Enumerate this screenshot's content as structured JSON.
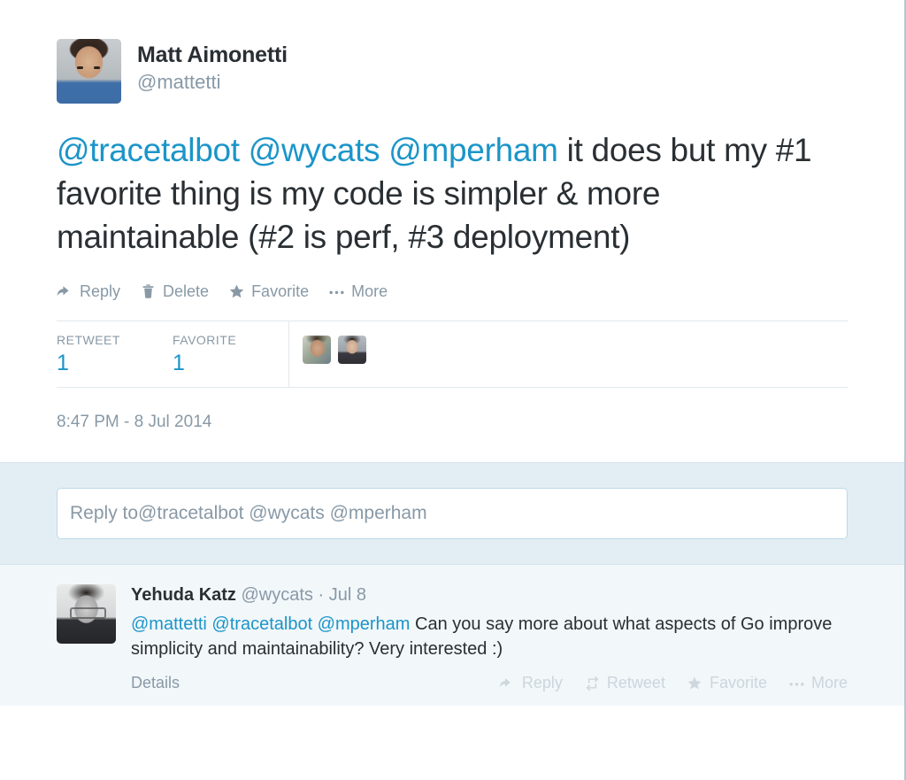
{
  "theme": {
    "link_blue": "#1b95c9",
    "text_dark": "#292f33",
    "muted_gray": "#8899a6",
    "compose_band_bg": "#e3eef4",
    "reply_band_bg": "#f2f7fa",
    "border_gray": "#e1e8ed"
  },
  "tweet": {
    "author": {
      "display_name": "Matt Aimonetti",
      "handle": "@mattetti",
      "avatar_icon": "avatar-matt-aimonetti"
    },
    "text_segments": [
      {
        "type": "mention",
        "text": "@tracetalbot"
      },
      {
        "type": "plain",
        "text": " "
      },
      {
        "type": "mention",
        "text": "@wycats"
      },
      {
        "type": "plain",
        "text": " "
      },
      {
        "type": "mention",
        "text": "@mperham"
      },
      {
        "type": "plain",
        "text": " it does but my #1 favorite thing is my code is simpler & more maintainable (#2 is perf, #3 deployment)"
      }
    ],
    "full_text": "@tracetalbot @wycats @mperham it does but my #1 favorite thing is my code is simpler & more maintainable (#2 is perf, #3 deployment)",
    "actions": [
      {
        "label": "Reply",
        "icon": "reply-arrow-icon"
      },
      {
        "label": "Delete",
        "icon": "trash-icon"
      },
      {
        "label": "Favorite",
        "icon": "star-icon"
      },
      {
        "label": "More",
        "icon": "ellipsis-icon"
      }
    ],
    "stats": [
      {
        "label": "RETWEET",
        "value": "1"
      },
      {
        "label": "FAVORITE",
        "value": "1"
      }
    ],
    "engager_avatars": [
      {
        "icon": "avatar-engager-one"
      },
      {
        "icon": "avatar-engager-two"
      }
    ],
    "timestamp": "8:47 PM - 8 Jul 2014"
  },
  "compose": {
    "prefix": "Reply to ",
    "mentions": "@tracetalbot @wycats @mperham",
    "placeholder": "Reply to @tracetalbot @wycats @mperham"
  },
  "reply": {
    "author": {
      "display_name": "Yehuda Katz",
      "handle": "@wycats",
      "avatar_icon": "avatar-yehuda-katz"
    },
    "separator": " · ",
    "date": "Jul 8",
    "mentions": "@mattetti @tracetalbot @mperham",
    "body": " Can you say more about what aspects of Go improve simplicity and maintainability? Very interested :)",
    "full_text": "@mattetti @tracetalbot @mperham Can you say more about what aspects of Go improve simplicity and maintainability? Very interested :)",
    "details_label": "Details",
    "actions": [
      {
        "label": "Reply",
        "icon": "reply-arrow-icon"
      },
      {
        "label": "Retweet",
        "icon": "retweet-icon"
      },
      {
        "label": "Favorite",
        "icon": "star-icon"
      },
      {
        "label": "More",
        "icon": "ellipsis-icon"
      }
    ]
  }
}
